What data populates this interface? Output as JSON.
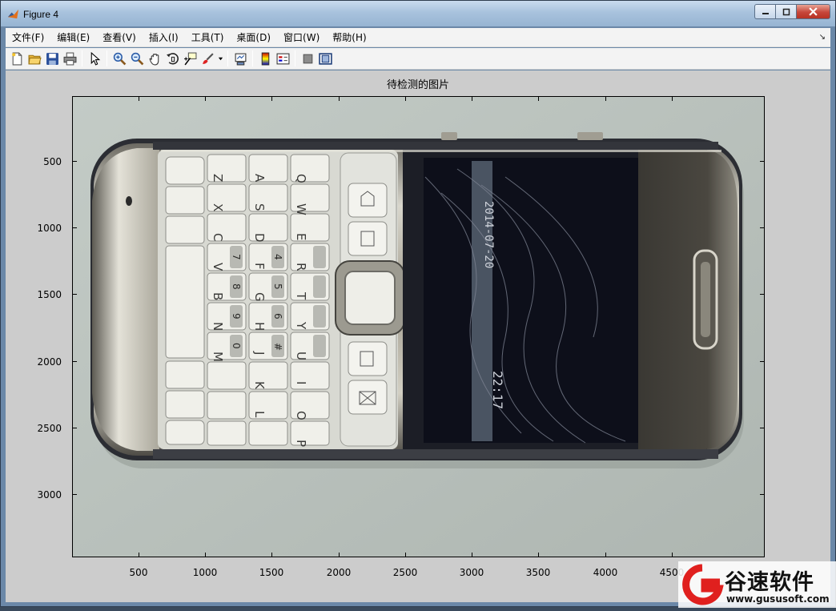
{
  "window": {
    "title": "Figure 4",
    "buttons": [
      "minimize",
      "maximize",
      "close"
    ]
  },
  "menubar": {
    "items": [
      "文件(F)",
      "编辑(E)",
      "查看(V)",
      "插入(I)",
      "工具(T)",
      "桌面(D)",
      "窗口(W)",
      "帮助(H)"
    ],
    "overflow": "↘"
  },
  "toolbar": {
    "icons": [
      "new-figure-icon",
      "open-file-icon",
      "save-icon",
      "print-icon",
      "pointer-icon",
      "zoom-in-icon",
      "zoom-out-icon",
      "pan-icon",
      "rotate-3d-icon",
      "data-cursor-icon",
      "brush-icon",
      "link-plot-icon",
      "colorbar-icon",
      "legend-icon",
      "hide-plot-tools-icon",
      "show-plot-tools-icon"
    ]
  },
  "plot": {
    "title": "待检测的图片",
    "y_ticks": [
      "500",
      "1000",
      "1500",
      "2000",
      "2500",
      "3000"
    ],
    "x_ticks": [
      "500",
      "1000",
      "1500",
      "2000",
      "2500",
      "3000",
      "3500",
      "4000",
      "4500"
    ],
    "image_subject": "phone-photo"
  },
  "phone_screen": {
    "date": "2014-07-20",
    "time": "22:17"
  },
  "keyboard": {
    "rows": [
      [
        "Z",
        "A",
        "Q"
      ],
      [
        "X",
        "S",
        "W"
      ],
      [
        "C",
        "D",
        "E"
      ],
      [
        "V",
        "F",
        "R",
        "1"
      ],
      [
        "B",
        "G",
        "T",
        "2"
      ],
      [
        "N",
        "H",
        "Y",
        "3"
      ],
      [
        "M",
        "J",
        "U",
        "*"
      ],
      [
        "K",
        "I",
        "+"
      ],
      [
        "L",
        "O"
      ],
      [
        "P"
      ]
    ],
    "number_keys": [
      "7",
      "8",
      "9",
      "0",
      "4",
      "5",
      "6",
      "#"
    ]
  },
  "watermark": {
    "brand": "谷速软件",
    "url": "www.gususoft.com"
  },
  "colors": {
    "titlebar": "#a8c2dd",
    "figure_bg": "#cccccc",
    "close": "#c6463a"
  }
}
